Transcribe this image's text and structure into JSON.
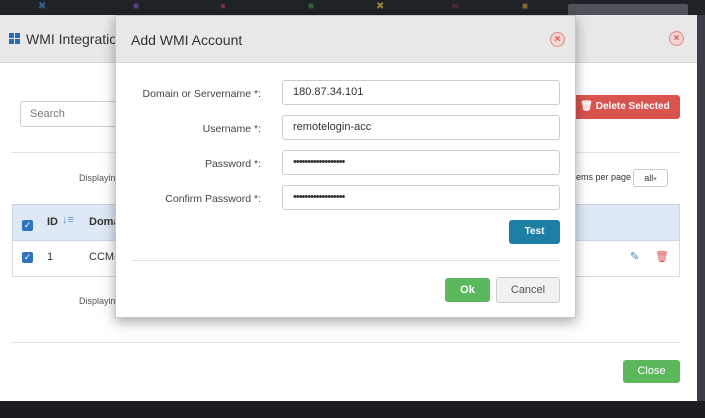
{
  "topbar": {
    "icons": [
      {
        "name": "x-icon",
        "glyph": "✖",
        "color": "#3a73b5"
      },
      {
        "name": "square-icon",
        "glyph": "■",
        "color": "#6b4aa0"
      },
      {
        "name": "record-icon",
        "glyph": "●",
        "color": "#a8323e"
      },
      {
        "name": "box-icon",
        "glyph": "■",
        "color": "#2f7a44"
      },
      {
        "name": "cross-icon",
        "glyph": "✖",
        "color": "#c2a233"
      },
      {
        "name": "link-icon",
        "glyph": "∞",
        "color": "#b03a5a"
      },
      {
        "name": "doc-icon",
        "glyph": "■",
        "color": "#b07a2a"
      }
    ]
  },
  "outer": {
    "title": "WMI Integratio",
    "search_placeholder": "Search",
    "delete_selected_label": "Delete Selected",
    "displaying_top": "Displayin",
    "displaying_bottom": "Displayin",
    "items_per_page_label": "ems per page",
    "items_per_page_value": "all",
    "table": {
      "headers": {
        "id": "ID",
        "domain": "Doma"
      },
      "rows": [
        {
          "id": "1",
          "domain": "CCM-"
        }
      ]
    },
    "close_label": "Close"
  },
  "modal": {
    "title": "Add WMI Account",
    "fields": {
      "domain": {
        "label": "Domain or Servername *:",
        "value": "180.87.34.101"
      },
      "username": {
        "label": "Username *:",
        "value": "remotelogin-acc"
      },
      "password": {
        "label": "Password *:",
        "value": "••••••••••••••••••"
      },
      "confirm": {
        "label": "Confirm Password *:",
        "value": "••••••••••••••••••"
      }
    },
    "test_label": "Test",
    "ok_label": "Ok",
    "cancel_label": "Cancel"
  },
  "colors": {
    "danger": "#d9534f",
    "success": "#5cb85c",
    "primary": "#1e7fa4",
    "header_bg": "#e8e8e8"
  }
}
